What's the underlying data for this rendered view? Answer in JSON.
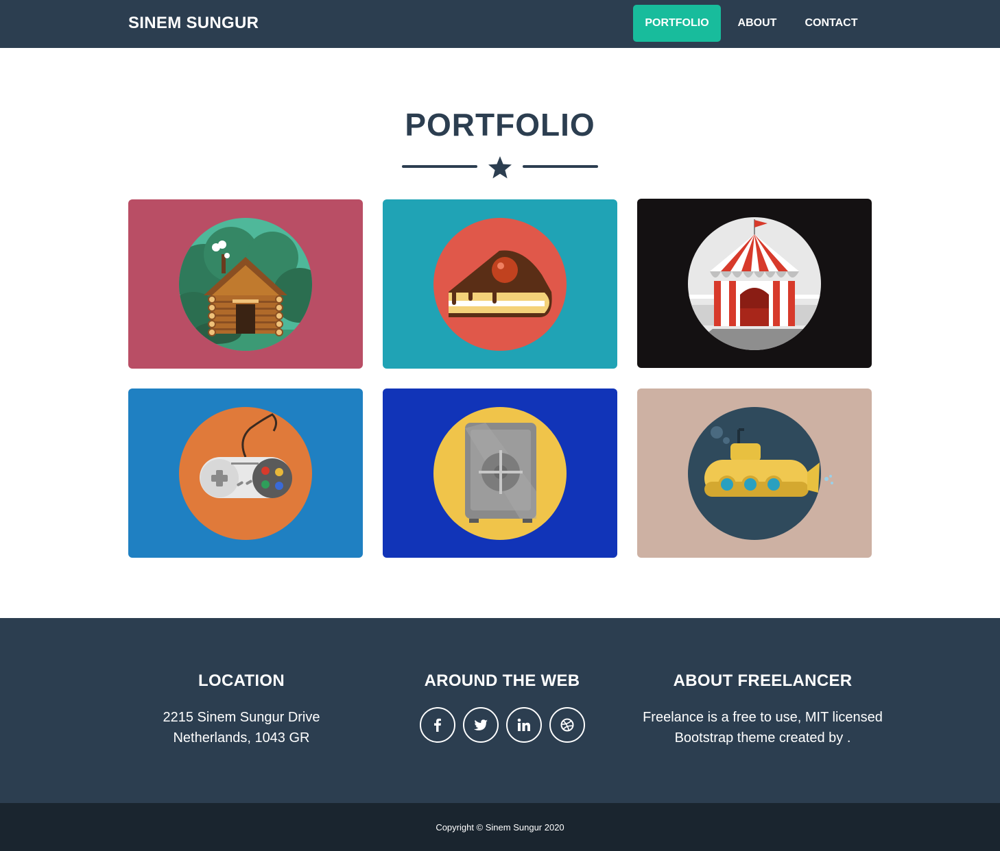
{
  "navbar": {
    "brand": "SINEM SUNGUR",
    "items": [
      {
        "label": "PORTFOLIO",
        "active": true
      },
      {
        "label": "ABOUT",
        "active": false
      },
      {
        "label": "CONTACT",
        "active": false
      }
    ]
  },
  "portfolio": {
    "title": "PORTFOLIO",
    "divider_icon": "star-icon",
    "items": [
      {
        "icon": "cabin-icon",
        "background": "#b94e65",
        "circle": "#3a8f73"
      },
      {
        "icon": "cake-icon",
        "background": "#20a3b5",
        "circle": "#e0584a"
      },
      {
        "icon": "circus-tent-icon",
        "background": "#141112",
        "circle": "#e8e8e8"
      },
      {
        "icon": "game-controller-icon",
        "background": "#1f80c2",
        "circle": "#e07a3a"
      },
      {
        "icon": "safe-icon",
        "background": "#1134b8",
        "circle": "#f0c44a"
      },
      {
        "icon": "submarine-icon",
        "background": "#cdb1a3",
        "circle": "#2f4a5c"
      }
    ]
  },
  "footer": {
    "location": {
      "heading": "LOCATION",
      "line1": "2215 Sinem Sungur Drive",
      "line2": "Netherlands, 1043 GR"
    },
    "web": {
      "heading": "AROUND THE WEB",
      "links": [
        "facebook-icon",
        "twitter-icon",
        "linkedin-icon",
        "dribbble-icon"
      ]
    },
    "about": {
      "heading": "ABOUT FREELANCER",
      "line1": "Freelance is a free to use, MIT licensed",
      "line2": "Bootstrap theme created by ."
    },
    "copyright": "Copyright © Sinem Sungur 2020"
  },
  "colors": {
    "primary": "#2c3e50",
    "accent": "#18bc9c",
    "copyright_bg": "#1a252f"
  }
}
